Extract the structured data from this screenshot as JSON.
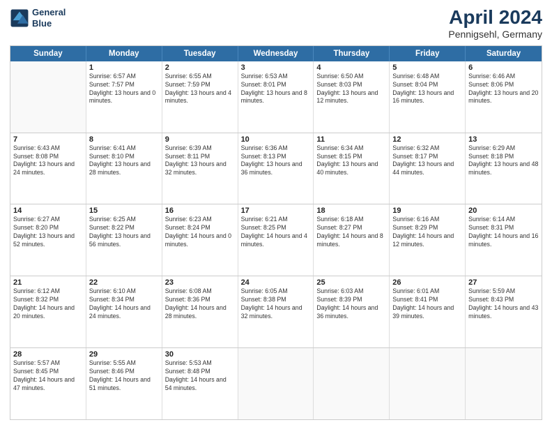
{
  "header": {
    "logo_line1": "General",
    "logo_line2": "Blue",
    "title": "April 2024",
    "subtitle": "Pennigsehl, Germany"
  },
  "days_of_week": [
    "Sunday",
    "Monday",
    "Tuesday",
    "Wednesday",
    "Thursday",
    "Friday",
    "Saturday"
  ],
  "weeks": [
    [
      {
        "day": "",
        "sunrise": "",
        "sunset": "",
        "daylight": ""
      },
      {
        "day": "1",
        "sunrise": "Sunrise: 6:57 AM",
        "sunset": "Sunset: 7:57 PM",
        "daylight": "Daylight: 13 hours and 0 minutes."
      },
      {
        "day": "2",
        "sunrise": "Sunrise: 6:55 AM",
        "sunset": "Sunset: 7:59 PM",
        "daylight": "Daylight: 13 hours and 4 minutes."
      },
      {
        "day": "3",
        "sunrise": "Sunrise: 6:53 AM",
        "sunset": "Sunset: 8:01 PM",
        "daylight": "Daylight: 13 hours and 8 minutes."
      },
      {
        "day": "4",
        "sunrise": "Sunrise: 6:50 AM",
        "sunset": "Sunset: 8:03 PM",
        "daylight": "Daylight: 13 hours and 12 minutes."
      },
      {
        "day": "5",
        "sunrise": "Sunrise: 6:48 AM",
        "sunset": "Sunset: 8:04 PM",
        "daylight": "Daylight: 13 hours and 16 minutes."
      },
      {
        "day": "6",
        "sunrise": "Sunrise: 6:46 AM",
        "sunset": "Sunset: 8:06 PM",
        "daylight": "Daylight: 13 hours and 20 minutes."
      }
    ],
    [
      {
        "day": "7",
        "sunrise": "Sunrise: 6:43 AM",
        "sunset": "Sunset: 8:08 PM",
        "daylight": "Daylight: 13 hours and 24 minutes."
      },
      {
        "day": "8",
        "sunrise": "Sunrise: 6:41 AM",
        "sunset": "Sunset: 8:10 PM",
        "daylight": "Daylight: 13 hours and 28 minutes."
      },
      {
        "day": "9",
        "sunrise": "Sunrise: 6:39 AM",
        "sunset": "Sunset: 8:11 PM",
        "daylight": "Daylight: 13 hours and 32 minutes."
      },
      {
        "day": "10",
        "sunrise": "Sunrise: 6:36 AM",
        "sunset": "Sunset: 8:13 PM",
        "daylight": "Daylight: 13 hours and 36 minutes."
      },
      {
        "day": "11",
        "sunrise": "Sunrise: 6:34 AM",
        "sunset": "Sunset: 8:15 PM",
        "daylight": "Daylight: 13 hours and 40 minutes."
      },
      {
        "day": "12",
        "sunrise": "Sunrise: 6:32 AM",
        "sunset": "Sunset: 8:17 PM",
        "daylight": "Daylight: 13 hours and 44 minutes."
      },
      {
        "day": "13",
        "sunrise": "Sunrise: 6:29 AM",
        "sunset": "Sunset: 8:18 PM",
        "daylight": "Daylight: 13 hours and 48 minutes."
      }
    ],
    [
      {
        "day": "14",
        "sunrise": "Sunrise: 6:27 AM",
        "sunset": "Sunset: 8:20 PM",
        "daylight": "Daylight: 13 hours and 52 minutes."
      },
      {
        "day": "15",
        "sunrise": "Sunrise: 6:25 AM",
        "sunset": "Sunset: 8:22 PM",
        "daylight": "Daylight: 13 hours and 56 minutes."
      },
      {
        "day": "16",
        "sunrise": "Sunrise: 6:23 AM",
        "sunset": "Sunset: 8:24 PM",
        "daylight": "Daylight: 14 hours and 0 minutes."
      },
      {
        "day": "17",
        "sunrise": "Sunrise: 6:21 AM",
        "sunset": "Sunset: 8:25 PM",
        "daylight": "Daylight: 14 hours and 4 minutes."
      },
      {
        "day": "18",
        "sunrise": "Sunrise: 6:18 AM",
        "sunset": "Sunset: 8:27 PM",
        "daylight": "Daylight: 14 hours and 8 minutes."
      },
      {
        "day": "19",
        "sunrise": "Sunrise: 6:16 AM",
        "sunset": "Sunset: 8:29 PM",
        "daylight": "Daylight: 14 hours and 12 minutes."
      },
      {
        "day": "20",
        "sunrise": "Sunrise: 6:14 AM",
        "sunset": "Sunset: 8:31 PM",
        "daylight": "Daylight: 14 hours and 16 minutes."
      }
    ],
    [
      {
        "day": "21",
        "sunrise": "Sunrise: 6:12 AM",
        "sunset": "Sunset: 8:32 PM",
        "daylight": "Daylight: 14 hours and 20 minutes."
      },
      {
        "day": "22",
        "sunrise": "Sunrise: 6:10 AM",
        "sunset": "Sunset: 8:34 PM",
        "daylight": "Daylight: 14 hours and 24 minutes."
      },
      {
        "day": "23",
        "sunrise": "Sunrise: 6:08 AM",
        "sunset": "Sunset: 8:36 PM",
        "daylight": "Daylight: 14 hours and 28 minutes."
      },
      {
        "day": "24",
        "sunrise": "Sunrise: 6:05 AM",
        "sunset": "Sunset: 8:38 PM",
        "daylight": "Daylight: 14 hours and 32 minutes."
      },
      {
        "day": "25",
        "sunrise": "Sunrise: 6:03 AM",
        "sunset": "Sunset: 8:39 PM",
        "daylight": "Daylight: 14 hours and 36 minutes."
      },
      {
        "day": "26",
        "sunrise": "Sunrise: 6:01 AM",
        "sunset": "Sunset: 8:41 PM",
        "daylight": "Daylight: 14 hours and 39 minutes."
      },
      {
        "day": "27",
        "sunrise": "Sunrise: 5:59 AM",
        "sunset": "Sunset: 8:43 PM",
        "daylight": "Daylight: 14 hours and 43 minutes."
      }
    ],
    [
      {
        "day": "28",
        "sunrise": "Sunrise: 5:57 AM",
        "sunset": "Sunset: 8:45 PM",
        "daylight": "Daylight: 14 hours and 47 minutes."
      },
      {
        "day": "29",
        "sunrise": "Sunrise: 5:55 AM",
        "sunset": "Sunset: 8:46 PM",
        "daylight": "Daylight: 14 hours and 51 minutes."
      },
      {
        "day": "30",
        "sunrise": "Sunrise: 5:53 AM",
        "sunset": "Sunset: 8:48 PM",
        "daylight": "Daylight: 14 hours and 54 minutes."
      },
      {
        "day": "",
        "sunrise": "",
        "sunset": "",
        "daylight": ""
      },
      {
        "day": "",
        "sunrise": "",
        "sunset": "",
        "daylight": ""
      },
      {
        "day": "",
        "sunrise": "",
        "sunset": "",
        "daylight": ""
      },
      {
        "day": "",
        "sunrise": "",
        "sunset": "",
        "daylight": ""
      }
    ]
  ]
}
